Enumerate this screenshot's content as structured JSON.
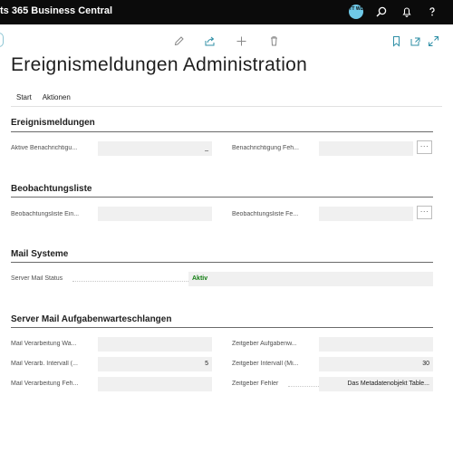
{
  "app": {
    "title": "ts 365 Business Central",
    "user_initials": "TT WL"
  },
  "page": {
    "title": "Ereignismeldungen Administration",
    "tabs": [
      "Start",
      "Aktionen"
    ]
  },
  "sections": {
    "ereignis": {
      "title": "Ereignismeldungen",
      "left_label": "Aktive Benachrichtigu...",
      "left_value": "_",
      "right_label": "Benachrichtigung Feh...",
      "right_value": ""
    },
    "beobachtung": {
      "title": "Beobachtungsliste",
      "left_label": "Beobachtungsliste Ein...",
      "left_value": "",
      "right_label": "Beobachtungsliste Fe...",
      "right_value": ""
    },
    "mail": {
      "title": "Mail Systeme",
      "label": "Server Mail Status",
      "value": "Aktiv"
    },
    "queue": {
      "title": "Server Mail Aufgabenwarteschlangen",
      "row1_left_label": "Mail Verarbeitung Wa...",
      "row1_right_label": "Zeitgeber Aufgabenw...",
      "row2_left_label": "Mail Verarb. Intervall (...",
      "row2_left_value": "5",
      "row2_right_label": "Zeitgeber Intervall (Mi...",
      "row2_right_value": "30",
      "row3_left_label": "Mail Verarbeitung Feh...",
      "row3_left_value": "",
      "row3_right_label": "Zeitgeber Fehler",
      "row3_right_value": "Das Metadatenobjekt Table..."
    }
  },
  "more_label": "···",
  "colors": {
    "appbar": "#0b0b0b",
    "accent": "#008489",
    "status_active": "#107c10"
  }
}
